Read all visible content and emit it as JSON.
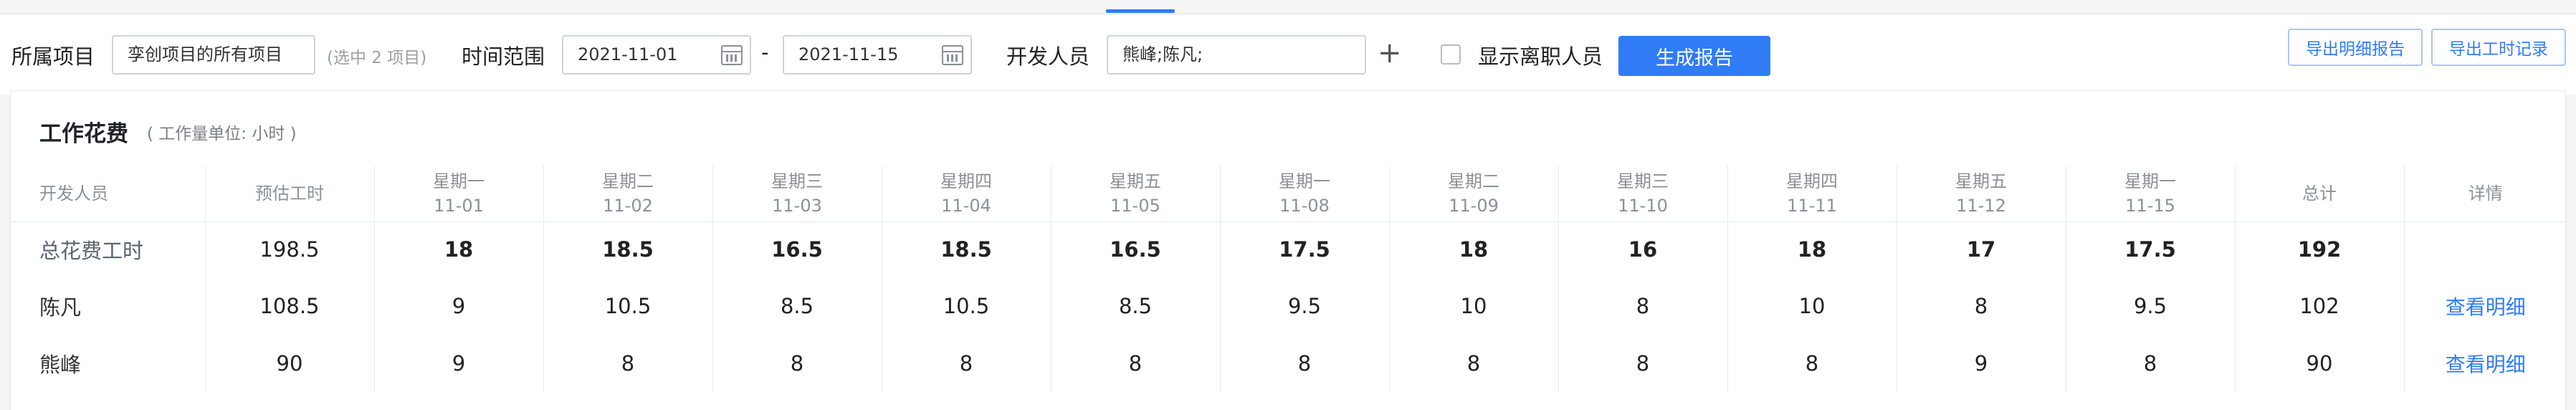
{
  "filters": {
    "project_label": "所属项目",
    "project_value": "孪创项目的所有项目",
    "project_hint": "(选中 2 项目)",
    "range_label": "时间范围",
    "start_date": "2021-11-01",
    "range_separator": "-",
    "end_date": "2021-11-15",
    "developer_label": "开发人员",
    "developer_value": "熊峰;陈凡;",
    "add_symbol": "+",
    "show_resigned_label": "显示离职人员",
    "show_resigned_checked": false,
    "generate_label": "生成报告",
    "export_detail_label": "导出明细报告",
    "export_hours_label": "导出工时记录"
  },
  "panel": {
    "title": "工作花费",
    "unit_note": "( 工作量单位: 小时 )"
  },
  "table": {
    "headers": {
      "developer": "开发人员",
      "estimate": "预估工时",
      "total": "总计",
      "details": "详情"
    },
    "days": [
      {
        "weekday": "星期一",
        "date": "11-01"
      },
      {
        "weekday": "星期二",
        "date": "11-02"
      },
      {
        "weekday": "星期三",
        "date": "11-03"
      },
      {
        "weekday": "星期四",
        "date": "11-04"
      },
      {
        "weekday": "星期五",
        "date": "11-05"
      },
      {
        "weekday": "星期一",
        "date": "11-08"
      },
      {
        "weekday": "星期二",
        "date": "11-09"
      },
      {
        "weekday": "星期三",
        "date": "11-10"
      },
      {
        "weekday": "星期四",
        "date": "11-11"
      },
      {
        "weekday": "星期五",
        "date": "11-12"
      },
      {
        "weekday": "星期一",
        "date": "11-15"
      }
    ],
    "rows": [
      {
        "name": "总花费工时",
        "estimate": "198.5",
        "hours": [
          "18",
          "18.5",
          "16.5",
          "18.5",
          "16.5",
          "17.5",
          "18",
          "16",
          "18",
          "17",
          "17.5"
        ],
        "total": "192",
        "detail": ""
      },
      {
        "name": "陈凡",
        "estimate": "108.5",
        "hours": [
          "9",
          "10.5",
          "8.5",
          "10.5",
          "8.5",
          "9.5",
          "10",
          "8",
          "10",
          "8",
          "9.5"
        ],
        "total": "102",
        "detail": "查看明细"
      },
      {
        "name": "熊峰",
        "estimate": "90",
        "hours": [
          "9",
          "8",
          "8",
          "8",
          "8",
          "8",
          "8",
          "8",
          "8",
          "9",
          "8"
        ],
        "total": "90",
        "detail": "查看明细"
      }
    ]
  },
  "colors": {
    "accent": "#2f7cf6",
    "border": "#e8eaed",
    "muted_text": "#8c9198"
  }
}
